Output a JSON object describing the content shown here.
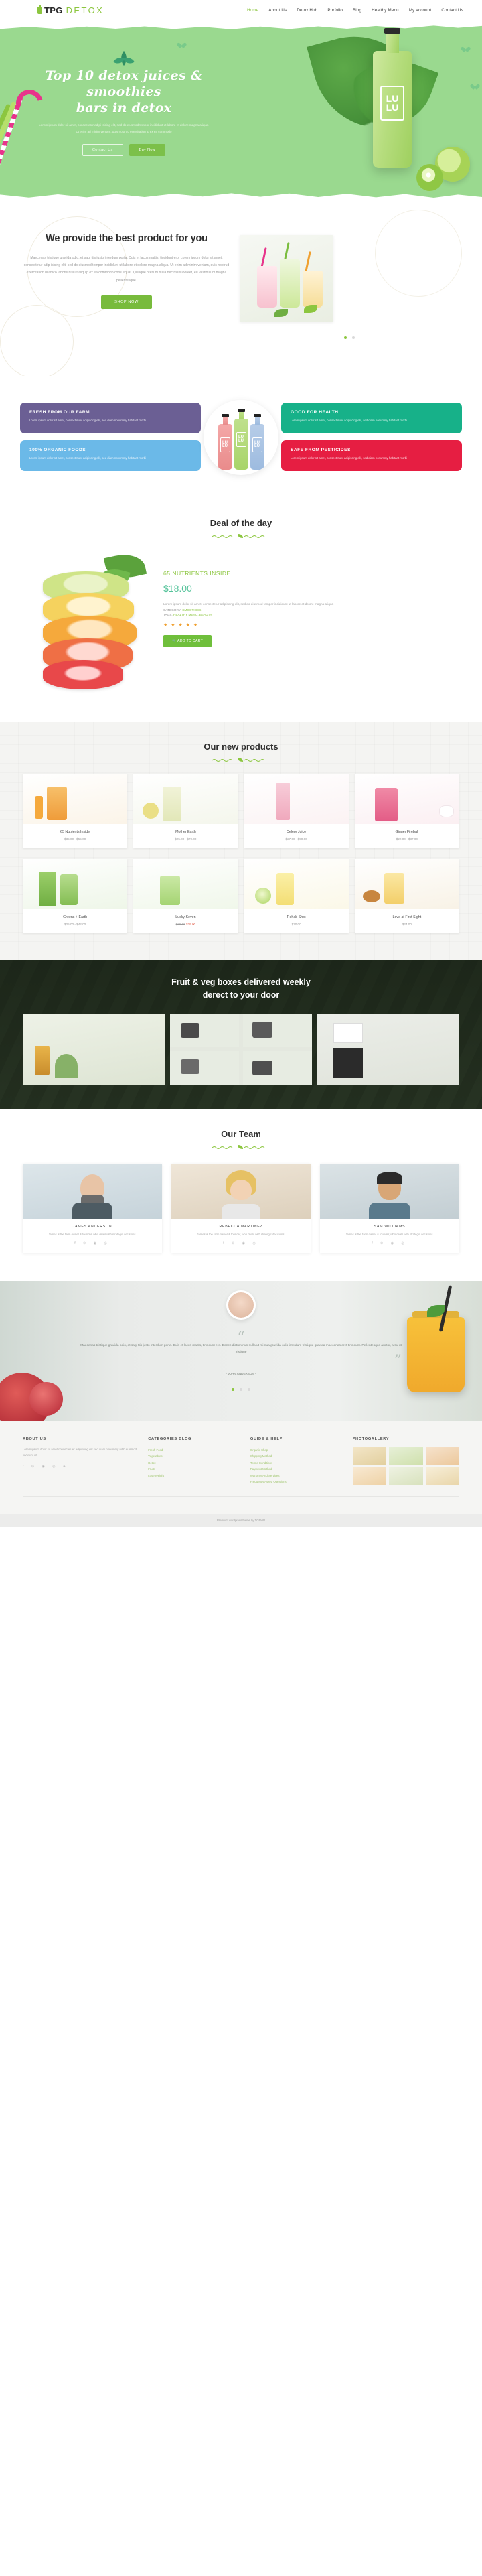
{
  "header": {
    "logo_tpg": "TPG",
    "logo_detox": "DETOX",
    "nav": [
      {
        "label": "Home",
        "active": true
      },
      {
        "label": "About Us",
        "active": false
      },
      {
        "label": "Detox Hub",
        "active": false
      },
      {
        "label": "Porfolio",
        "active": false
      },
      {
        "label": "Blog",
        "active": false
      },
      {
        "label": "Healthy Menu",
        "active": false
      },
      {
        "label": "My account",
        "active": false
      },
      {
        "label": "Contact Us",
        "active": false
      }
    ]
  },
  "hero": {
    "title_line1": "Top 10 detox juices & smoothies",
    "title_line2": "bars in detox",
    "subtitle": "Lorem ipsum dolor sit amet, consectetur adipi isicing elit, sed do eiusmod tempor incididunt ut labore et dolore magna aliqua. Ut enim ad minim veniam, quis nostrud exercitation ip ex ea commodo",
    "btn_outline": "Contact Us",
    "btn_primary": "Buy Now",
    "bottle_label": "LU LU"
  },
  "best": {
    "title": "We provide the best product for you",
    "paragraph": "Maecenas tristique gravida odio, et sagi ttis justo interdum porta. Duis et lacus mattis, tincidunt ero. Lorem ipsum dolor sit amet, consecttetur adip isicing elit, sed do eiusmod tempor incididunt ut labore et dolore magna aliqua. Ut enim ad minim veniam, quis nostrud exercitation ullamco laboris nisi ut aliquip ex ea commodo cons equat. Quisque pretium nulla nec risus looreet, eu vestibulum magna pellentesque.",
    "button": "SHOP NOW"
  },
  "features": {
    "boxes": [
      {
        "title": "FRESH FROM OUR FARM",
        "text": "Lorem ipsum dolor sit amet, consectetuer adipiscing elit, sed diam nonummy habitant morbi",
        "color": "#6b5f94"
      },
      {
        "title": "GOOD FOR HEALTH",
        "text": "Lorem ipsum dolor sit amet, consectetuer adipiscing elit, sed diam nonummy habitant morbi",
        "color": "#17b189"
      },
      {
        "title": "100% ORGANIC FOODS",
        "text": "Lorem ipsum dolor sit amet, consectetuer adipiscing elit, sed diam nonummy habitant morbi",
        "color": "#6bb9e8"
      },
      {
        "title": "SAFE FROM PESTICIDES",
        "text": "Lorem ipsum dolor sit amet, consectetuer adipiscing elit, sed diam nonummy habitant morbi",
        "color": "#e61e42"
      }
    ],
    "bottle_label": "LU LU"
  },
  "deal": {
    "title": "Deal of the day",
    "product_name": "65 NUTRIENTS INSIDE",
    "price": "$18.00",
    "description": "Lorem ipsum dolor sit amet, consectetur adipiscing elit, sed do eiusmod tempor incididunt ut labore et dolore magna aliqua",
    "category_label": "CATEGORY:",
    "category_value": "SMOOTHIES",
    "tags_label": "TAGS:",
    "tags_value": "HEALTHY MENU, BEAUTY",
    "stars": "★ ★ ★ ★ ★",
    "add_to_cart": "ADD TO CART"
  },
  "products": {
    "title": "Our new products",
    "items": [
      {
        "name": "65 Nutrients Inside",
        "price": "$35.00 - $55.00"
      },
      {
        "name": "Mother Earth",
        "price": "$25.00 - $70.00"
      },
      {
        "name": "Celery Juice",
        "price": "$27.00 - $50.00"
      },
      {
        "name": "Ginger Fireball",
        "price": "$22.00 - $37.00"
      },
      {
        "name": "Greens + Earth",
        "price": "$25.00 - $42.00"
      },
      {
        "name": "Lucky Seven",
        "price": "$36.00",
        "sale": "$29.00"
      },
      {
        "name": "Rehab Shot",
        "price": "$30.00"
      },
      {
        "name": "Love at First Sight",
        "price": "$24.00"
      }
    ]
  },
  "veg": {
    "title_line1": "Fruit & veg boxes delivered weekly",
    "title_line2": "derect to your door"
  },
  "team": {
    "title": "Our Team",
    "members": [
      {
        "name": "JAMES ANDERSON",
        "role": "James is the farm owner & founder, who deals with strategic decisions.",
        "social": "f  ⊙  ◉  ◎"
      },
      {
        "name": "REBECCA MARTINEZ",
        "role": "James is the farm owner & founder, who deals with strategic decisions.",
        "social": "f  ⊙  ◉  ◎"
      },
      {
        "name": "SAM WILLIAMS",
        "role": "James is the farm owner & founder, who deals with strategic decisions.",
        "social": "f  ⊙  ◉  ◎"
      }
    ]
  },
  "testimonial": {
    "text": "Maecenas tristique gravida odio, et sagi ttis justo interdum porta. Duis et lacus mattis, tincidunt ero. Donec dictum nun nulla ut mi nua gravida odio interdum tristique gravida maecenas eret tincidunt. Pellentesque auctor, arcu ut tristique",
    "author": "- JOHN ANDERSON -"
  },
  "footer": {
    "about": {
      "heading": "ABOUT US",
      "text": "Lorem ipsum dolor sit amet consectetuer adipiscing elit sed diam nonummy nibh euismod tincidunt ut",
      "social": "f  ⊙  ◉  ◎  ✈"
    },
    "categories": {
      "heading": "CATEGORIES BLOG",
      "items": [
        "Fresh Food",
        "Vegetables",
        "Detox",
        "Fruits",
        "Lose Weight"
      ]
    },
    "guide": {
      "heading": "GUIDE & HELP",
      "items": [
        "Organic Shop",
        "Shipping Method",
        "Terms Conditions",
        "Payment Method",
        "Warranty And Services",
        "Frequently Asked Questions"
      ]
    },
    "gallery": {
      "heading": "PHOTOGALLERY"
    },
    "copyright": "Premium wordpress theme by TGPWP"
  }
}
